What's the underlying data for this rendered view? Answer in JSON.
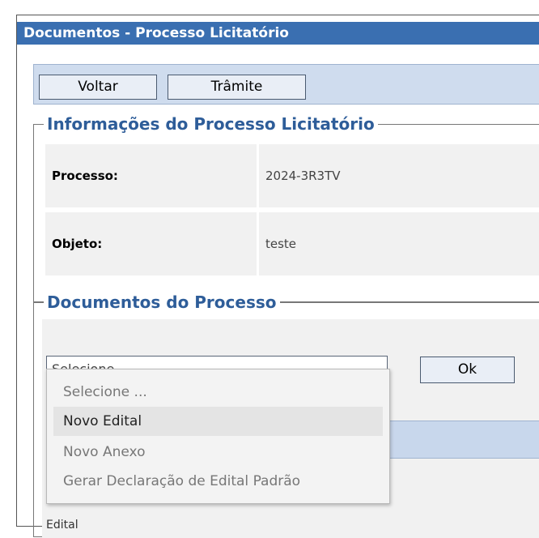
{
  "window": {
    "title": "Documentos - Processo Licitatório"
  },
  "toolbar": {
    "back_label": "Voltar",
    "tramite_label": "Trâmite"
  },
  "info": {
    "legend": "Informações do Processo Licitatório",
    "process_label": "Processo:",
    "process_value": "2024-3R3TV",
    "object_label": "Objeto:",
    "object_value": "teste"
  },
  "docs": {
    "legend": "Documentos do Processo",
    "select_value": "Selecione ...",
    "ok_label": "Ok",
    "partial_row_text": "Edital",
    "dropdown_options": [
      "Selecione ...",
      "Novo Edital",
      "Novo Anexo",
      "Gerar Declaração de Edital Padrão"
    ],
    "highlighted_option": "Novo Edital"
  },
  "icons": {
    "select_arrow": "chevron-down-icon"
  },
  "colors": {
    "title_bar": "#3a6fb1",
    "legend_text": "#2e5d99",
    "toolbar_bg": "#cfdcee"
  }
}
